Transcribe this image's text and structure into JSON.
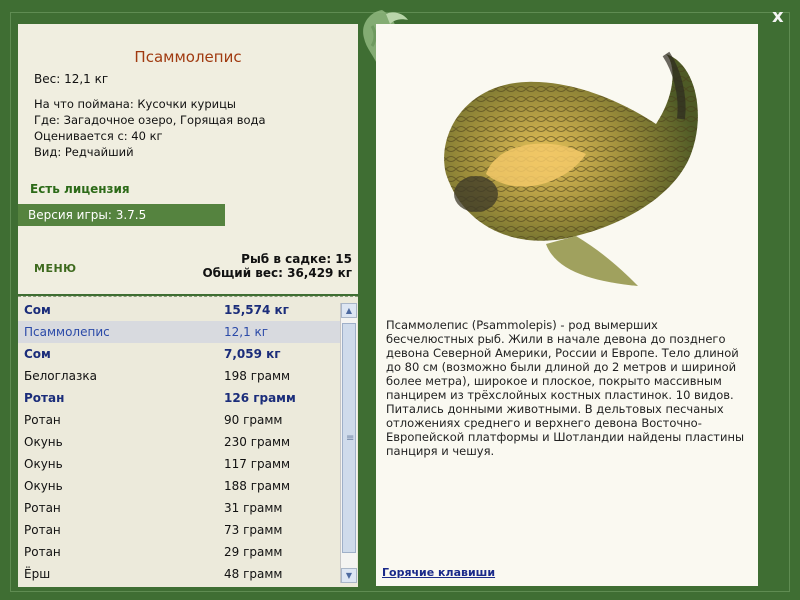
{
  "fish": {
    "name": "Псаммолепис",
    "weight": "Вес: 12,1 кг",
    "bait": "На что поймана: Кусочки курицы",
    "location": "Где: Загадочное озеро, Горящая вода",
    "value": "Оценивается с: 40 кг",
    "rarity": "Вид: Редчайший"
  },
  "license": "Есть лицензия",
  "version": "Версия игры: 3.7.5",
  "menu_label": "МЕНЮ",
  "stats": {
    "fish_count": "Рыб в садке: 15",
    "total_weight": "Общий вес: 36,429 кг"
  },
  "catch_list": [
    {
      "name": "Сом",
      "weight": "15,574 кг",
      "style": "bold"
    },
    {
      "name": "Псаммолепис",
      "weight": "12,1 кг",
      "style": "sel"
    },
    {
      "name": "Сом",
      "weight": "7,059 кг",
      "style": "bold"
    },
    {
      "name": "Белоглазка",
      "weight": "198 грамм",
      "style": "plain"
    },
    {
      "name": "Ротан",
      "weight": "126 грамм",
      "style": "bold"
    },
    {
      "name": "Ротан",
      "weight": "90 грамм",
      "style": "plain"
    },
    {
      "name": "Окунь",
      "weight": "230 грамм",
      "style": "plain"
    },
    {
      "name": "Окунь",
      "weight": "117 грамм",
      "style": "plain"
    },
    {
      "name": "Окунь",
      "weight": "188 грамм",
      "style": "plain"
    },
    {
      "name": "Ротан",
      "weight": "31 грамм",
      "style": "plain"
    },
    {
      "name": "Ротан",
      "weight": "73 грамм",
      "style": "plain"
    },
    {
      "name": "Ротан",
      "weight": "29 грамм",
      "style": "plain"
    },
    {
      "name": "Ёрш",
      "weight": "48 грамм",
      "style": "plain"
    }
  ],
  "description": "Псаммолепис (Psammolepis) - род вымерших бесчелюстных рыб. Жили в начале девона до позднего девона Северной Америки, России и Европе. Тело длиной до 80 см (возможно были длиной до 2 метров и шириной более метра), широкое и плоское, покрыто массивным панцирем из трёхслойных костных пластинок. 10 видов. Питались донными животными. В дельтовых песчаных отложениях среднего и верхнего девона Восточно-Европейской платформы и Шотландии найдены пластины панциря и чешуя.",
  "hotkeys_label": "Горячие клавиши",
  "close_label": "x",
  "colors": {
    "frame": "#3f6e33",
    "title": "#a03a10",
    "license": "#2c6a18",
    "bold_row": "#1b2d7a",
    "selected_row_bg": "#d8dadf"
  },
  "icons": {
    "emblem": "fish-emblem-icon",
    "close": "close-icon",
    "image": "fish-illustration"
  }
}
